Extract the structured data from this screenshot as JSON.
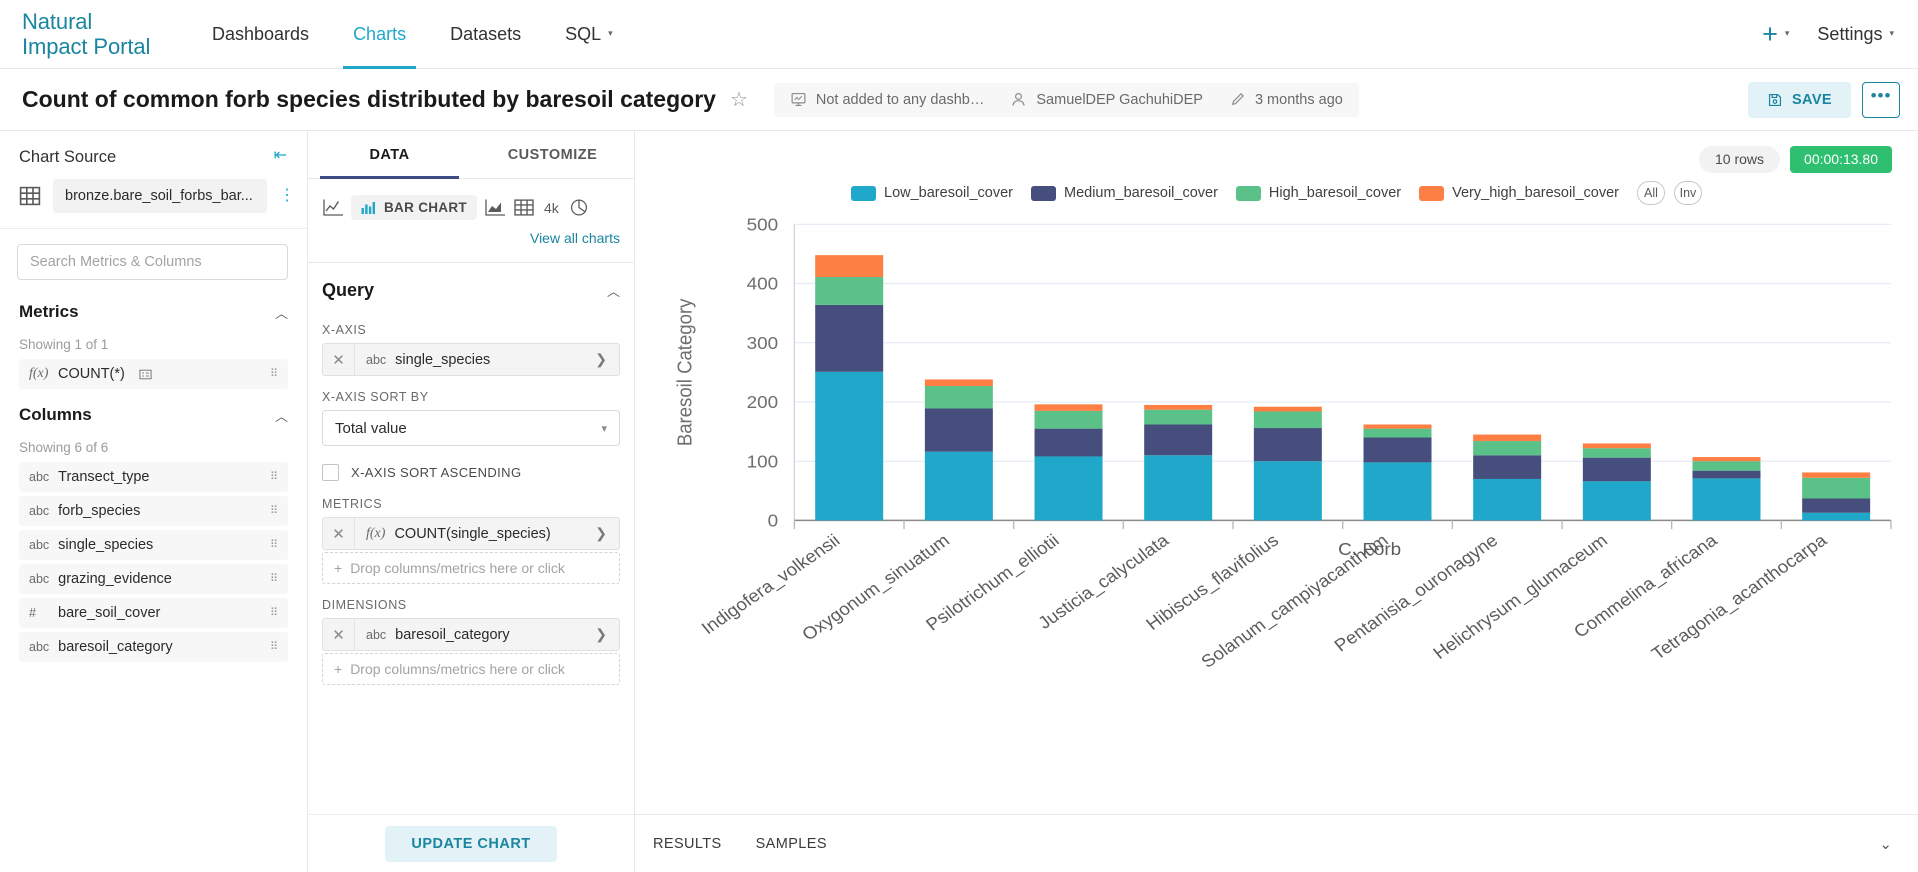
{
  "topnav": {
    "brand_line1": "Natural",
    "brand_line2": "Impact Portal",
    "items": [
      {
        "label": "Dashboards",
        "active": false,
        "caret": false
      },
      {
        "label": "Charts",
        "active": true,
        "caret": false
      },
      {
        "label": "Datasets",
        "active": false,
        "caret": false
      },
      {
        "label": "SQL",
        "active": false,
        "caret": true
      }
    ],
    "plus_label": "+",
    "settings_label": "Settings"
  },
  "titlebar": {
    "title": "Count of common forb species distributed by baresoil category",
    "dashboard_status": "Not added to any dashb…",
    "owner": "SamuelDEP GachuhiDEP",
    "modified": "3 months ago",
    "save_label": "SAVE",
    "more_label": "•••",
    "star_icon": "star-outline-icon"
  },
  "left_panel": {
    "heading": "Chart Source",
    "dataset_name": "bronze.bare_soil_forbs_bar...",
    "search_placeholder": "Search Metrics & Columns",
    "search_value": "",
    "metrics_section": {
      "title": "Metrics",
      "showing": "Showing 1 of 1",
      "items": [
        {
          "type": "f(x)",
          "name": "COUNT(*)",
          "has_info": true
        }
      ]
    },
    "columns_section": {
      "title": "Columns",
      "showing": "Showing 6 of 6",
      "items": [
        {
          "type": "abc",
          "name": "Transect_type"
        },
        {
          "type": "abc",
          "name": "forb_species"
        },
        {
          "type": "abc",
          "name": "single_species"
        },
        {
          "type": "abc",
          "name": "grazing_evidence"
        },
        {
          "type": "#",
          "name": "bare_soil_cover"
        },
        {
          "type": "abc",
          "name": "baresoil_category"
        }
      ]
    }
  },
  "mid_panel": {
    "tabs": [
      {
        "label": "DATA",
        "active": true
      },
      {
        "label": "CUSTOMIZE",
        "active": false
      }
    ],
    "viz_selected": "BAR CHART",
    "viz_4k": "4k",
    "view_all_label": "View all charts",
    "query_title": "Query",
    "x_axis_label": "X-AXIS",
    "x_axis_value": "single_species",
    "x_axis_type": "abc",
    "x_axis_sort_label": "X-AXIS SORT BY",
    "x_axis_sort_value": "Total value",
    "x_axis_sort_asc_label": "X-AXIS SORT ASCENDING",
    "x_axis_sort_asc_checked": false,
    "metrics_label": "METRICS",
    "metrics_value": "COUNT(single_species)",
    "metrics_type": "f(x)",
    "metrics_drop_placeholder": "Drop columns/metrics here or click",
    "dimensions_label": "DIMENSIONS",
    "dimensions_value": "baresoil_category",
    "dimensions_type": "abc",
    "dimensions_drop_placeholder": "Drop columns/metrics here or click",
    "update_button": "UPDATE CHART"
  },
  "chart_panel": {
    "rows_badge": "10 rows",
    "timer_badge": "00:00:13.80",
    "legend_all": "All",
    "legend_inv": "Inv",
    "bottom_tabs": [
      {
        "label": "RESULTS"
      },
      {
        "label": "SAMPLES"
      }
    ]
  },
  "colors": {
    "accent": "#1fa8c9",
    "brand_teal": "#1a85a0",
    "low": "#1fa8c9",
    "medium": "#454e7c",
    "high": "#5ac189",
    "very_high": "#fd7f44",
    "timer_green": "#2fbf71",
    "tab_indicator": "#3c4b81"
  },
  "chart_data": {
    "type": "bar",
    "stacked": true,
    "title": "",
    "xlabel": "C. Forb",
    "ylabel": "Baresoil Category",
    "ylim": [
      0,
      500
    ],
    "yticks": [
      0,
      100,
      200,
      300,
      400,
      500
    ],
    "grid": true,
    "legend_position": "top",
    "categories": [
      "Indigofera_volkensii",
      "Oxygonum_sinuatum",
      "Psilotrichum_elliotii",
      "Justicia_calyculata",
      "Hibiscus_flavifolius",
      "Solanum_campiyacanthum",
      "Pentanisia_ouronagyne",
      "Helichrysum_glumaceum",
      "Commelina_africana",
      "Tetragonia_acanthocarpa"
    ],
    "series": [
      {
        "name": "Low_baresoil_cover",
        "color": "#1fa8c9",
        "values": [
          251,
          116,
          108,
          110,
          100,
          98,
          70,
          66,
          71,
          13
        ]
      },
      {
        "name": "Medium_baresoil_cover",
        "color": "#454e7c",
        "values": [
          113,
          73,
          47,
          52,
          56,
          42,
          40,
          40,
          13,
          24
        ]
      },
      {
        "name": "High_baresoil_cover",
        "color": "#5ac189",
        "values": [
          47,
          38,
          30,
          25,
          28,
          15,
          24,
          16,
          16,
          35
        ]
      },
      {
        "name": "Very_high_baresoil_cover",
        "color": "#fd7f44",
        "values": [
          37,
          11,
          11,
          8,
          8,
          7,
          11,
          8,
          7,
          9
        ]
      }
    ]
  }
}
